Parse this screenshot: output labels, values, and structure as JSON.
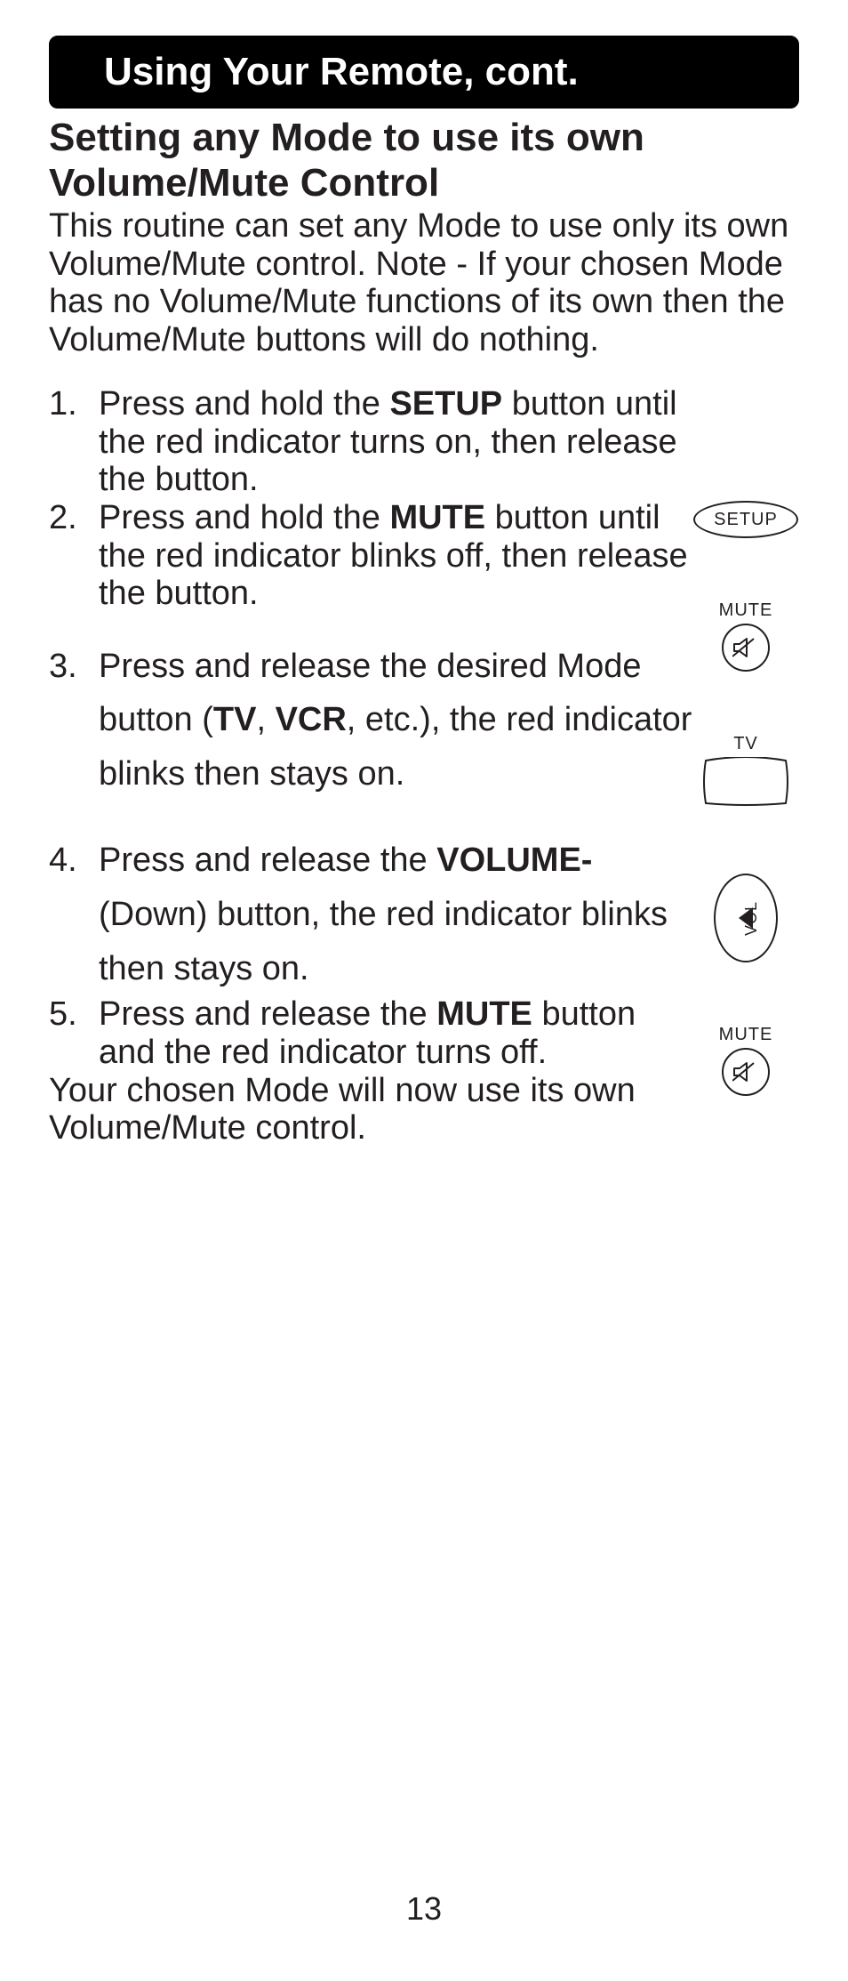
{
  "banner": "Using Your Remote, cont.",
  "subtitle": "Setting any Mode to use its own Volume/Mute Control",
  "intro": "This routine can set any Mode to use only its own Volume/Mute control. Note - If your chosen Mode has no Volume/Mute functions of its own then the Volume/Mute buttons will do nothing.",
  "steps": {
    "s1a": "Press and hold the ",
    "s1b": "SETUP",
    "s1c": " button until the red indicator turns on, then release the button.",
    "s2a": "Press and hold the ",
    "s2b": "MUTE",
    "s2c": " button until the red indicator blinks off, then release the button.",
    "s3a": "Press and release the desired Mode button (",
    "s3b": "TV",
    "s3c": ", ",
    "s3d": "VCR",
    "s3e": ", etc.), the red indicator blinks then stays on.",
    "s4a": "Press and release the ",
    "s4b": "VOLUME-",
    "s4c": " (Down) button, the red indicator blinks then stays on.",
    "s5a": "Press and release the ",
    "s5b": "MUTE",
    "s5c": " button and the red indicator turns off."
  },
  "outro": "Your chosen Mode will now use its own Volume/Mute control.",
  "page_number": "13",
  "icons": {
    "setup": "SETUP",
    "mute": "MUTE",
    "tv": "TV",
    "vol": "VOL"
  }
}
